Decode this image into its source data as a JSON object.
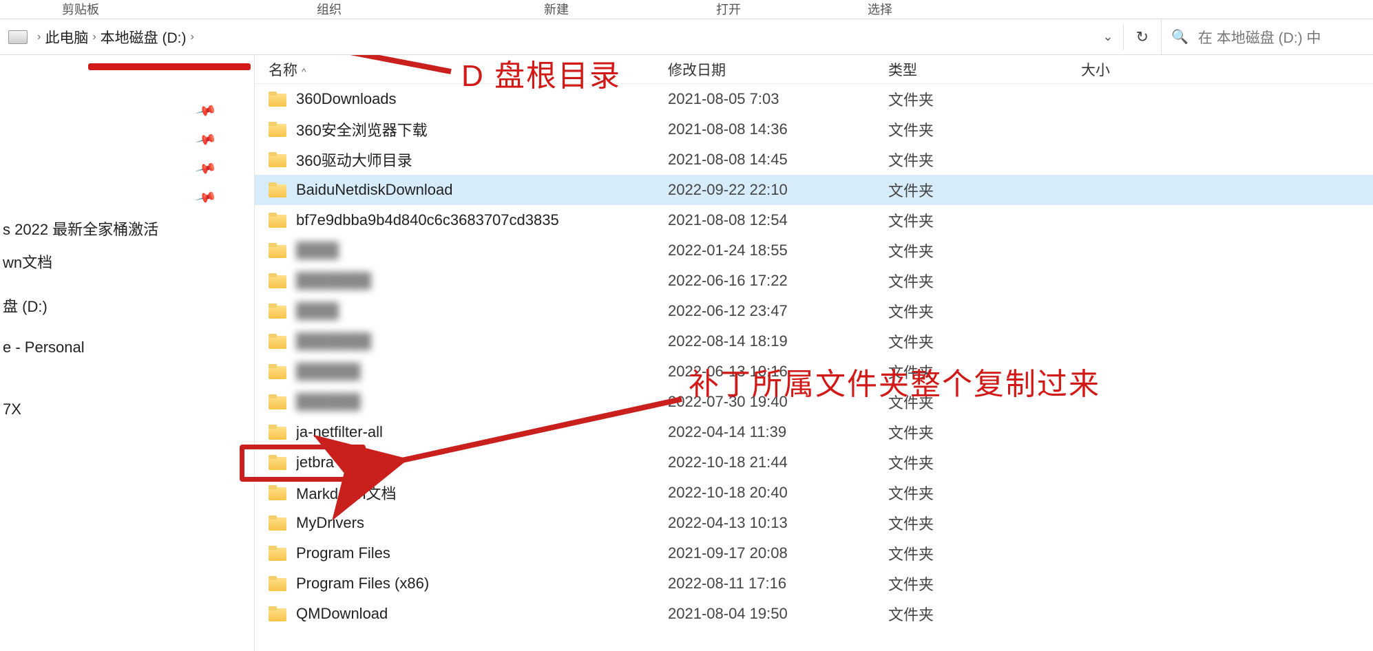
{
  "ribbon_groups": {
    "clipboard": "剪贴板",
    "organize": "组织",
    "new": "新建",
    "open": "打开",
    "select": "选择"
  },
  "breadcrumb": {
    "pc": "此电脑",
    "drive": "本地磁盘 (D:)"
  },
  "toolbar": {
    "refresh_glyph": "↻",
    "search_placeholder": "在 本地磁盘 (D:) 中"
  },
  "columns": {
    "name": "名称",
    "date": "修改日期",
    "type": "类型",
    "size": "大小"
  },
  "nav": {
    "pinned": [
      "",
      "",
      "",
      ""
    ],
    "items": [
      "s  2022 最新全家桶激活",
      "wn文档",
      "",
      "盘 (D:)",
      "",
      "e - Personal",
      "",
      "",
      "",
      "7X"
    ]
  },
  "rows": [
    {
      "name": "360Downloads",
      "date": "2021-08-05 7:03",
      "type": "文件夹",
      "sel": false
    },
    {
      "name": "360安全浏览器下载",
      "date": "2021-08-08 14:36",
      "type": "文件夹",
      "sel": false
    },
    {
      "name": "360驱动大师目录",
      "date": "2021-08-08 14:45",
      "type": "文件夹",
      "sel": false
    },
    {
      "name": "BaiduNetdiskDownload",
      "date": "2022-09-22 22:10",
      "type": "文件夹",
      "sel": true
    },
    {
      "name": "bf7e9dbba9b4d840c6c3683707cd3835",
      "date": "2021-08-08 12:54",
      "type": "文件夹",
      "sel": false
    },
    {
      "name": "████",
      "date": "2022-01-24 18:55",
      "type": "文件夹",
      "sel": false,
      "blur": true
    },
    {
      "name": "███████",
      "date": "2022-06-16 17:22",
      "type": "文件夹",
      "sel": false,
      "blur": true
    },
    {
      "name": "████",
      "date": "2022-06-12 23:47",
      "type": "文件夹",
      "sel": false,
      "blur": true
    },
    {
      "name": "███████",
      "date": "2022-08-14 18:19",
      "type": "文件夹",
      "sel": false,
      "blur": true
    },
    {
      "name": "██████",
      "date": "2022-06-13 10:16",
      "type": "文件夹",
      "sel": false,
      "blur": true
    },
    {
      "name": "██████",
      "date": "2022-07-30 19:40",
      "type": "文件夹",
      "sel": false,
      "blur": true
    },
    {
      "name": "ja-netfilter-all",
      "date": "2022-04-14 11:39",
      "type": "文件夹",
      "sel": false,
      "halfblur": true
    },
    {
      "name": "jetbra",
      "date": "2022-10-18 21:44",
      "type": "文件夹",
      "sel": false
    },
    {
      "name": "Markdown文档",
      "date": "2022-10-18 20:40",
      "type": "文件夹",
      "sel": false
    },
    {
      "name": "MyDrivers",
      "date": "2022-04-13 10:13",
      "type": "文件夹",
      "sel": false
    },
    {
      "name": "Program Files",
      "date": "2021-09-17 20:08",
      "type": "文件夹",
      "sel": false
    },
    {
      "name": "Program Files (x86)",
      "date": "2022-08-11 17:16",
      "type": "文件夹",
      "sel": false
    },
    {
      "name": "QMDownload",
      "date": "2021-08-04 19:50",
      "type": "文件夹",
      "sel": false
    }
  ],
  "annotations": {
    "root_label": "D 盘根目录",
    "copy_label": "补丁所属文件夹整个复制过来"
  }
}
